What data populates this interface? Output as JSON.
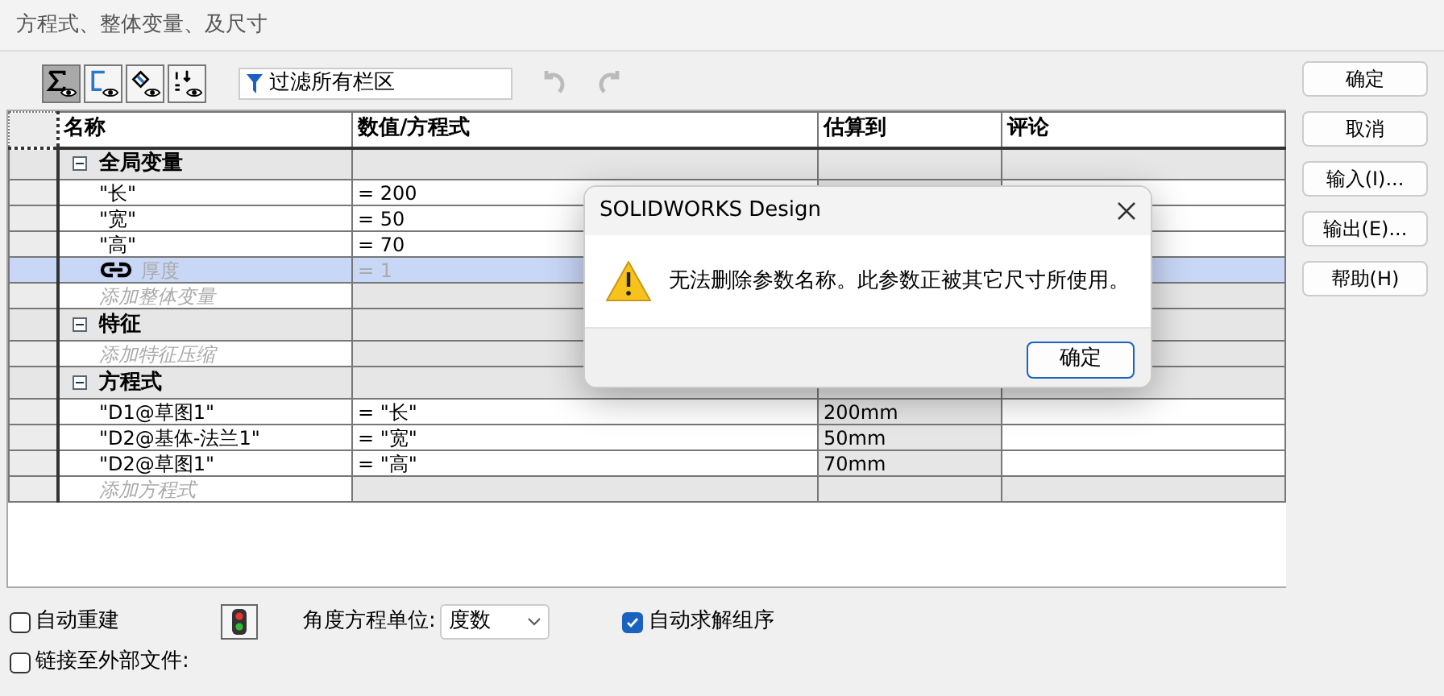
{
  "window": {
    "title": "方程式、整体变量、及尺寸"
  },
  "toolbar": {
    "view_buttons": [
      {
        "selected": true
      },
      {
        "selected": false
      },
      {
        "selected": false
      },
      {
        "selected": false
      }
    ],
    "filter": {
      "value": "过滤所有栏区"
    },
    "undo": {
      "disabled": true
    },
    "redo": {
      "disabled": true
    }
  },
  "table": {
    "columns": [
      "名称",
      "数值/方程式",
      "估算到",
      "评论"
    ],
    "sections": [
      {
        "title": "全局变量",
        "expanded": true,
        "rows": [
          {
            "kind": "item",
            "name": "\"长\"",
            "value": "= 200",
            "selected": false
          },
          {
            "kind": "item",
            "name": "\"宽\"",
            "value": "= 50",
            "selected": false
          },
          {
            "kind": "item",
            "name": "\"高\"",
            "value": "= 70",
            "selected": false
          },
          {
            "kind": "linked",
            "name": "厚度",
            "value": "= 1",
            "selected": true
          },
          {
            "kind": "add",
            "name": "添加整体变量",
            "selected": false
          }
        ]
      },
      {
        "title": "特征",
        "expanded": true,
        "rows": [
          {
            "kind": "add",
            "name": "添加特征压缩",
            "selected": false
          }
        ]
      },
      {
        "title": "方程式",
        "expanded": true,
        "rows": [
          {
            "kind": "item",
            "name": "\"D1@草图1\"",
            "value": "= \"长\"",
            "estimate": "200mm",
            "selected": false
          },
          {
            "kind": "item",
            "name": "\"D2@基体-法兰1\"",
            "value": "= \"宽\"",
            "estimate": "50mm",
            "selected": false
          },
          {
            "kind": "item",
            "name": "\"D2@草图1\"",
            "value": "= \"高\"",
            "estimate": "70mm",
            "selected": false
          },
          {
            "kind": "add",
            "name": "添加方程式",
            "selected": false
          }
        ]
      }
    ]
  },
  "options": {
    "auto_rebuild": {
      "label": "自动重建",
      "checked": false
    },
    "link_external": {
      "label": "链接至外部文件:",
      "checked": false
    },
    "angle_unit": {
      "label": "角度方程单位:",
      "value": "度数"
    },
    "auto_solve_order": {
      "label": "自动求解组序",
      "checked": true
    }
  },
  "buttons": [
    "确定",
    "取消",
    "输入(I)...",
    "输出(E)...",
    "帮助(H)"
  ],
  "dialog": {
    "title": "SOLIDWORKS Design",
    "message": "无法删除参数名称。此参数正被其它尺寸所使用。",
    "button": "确定"
  }
}
